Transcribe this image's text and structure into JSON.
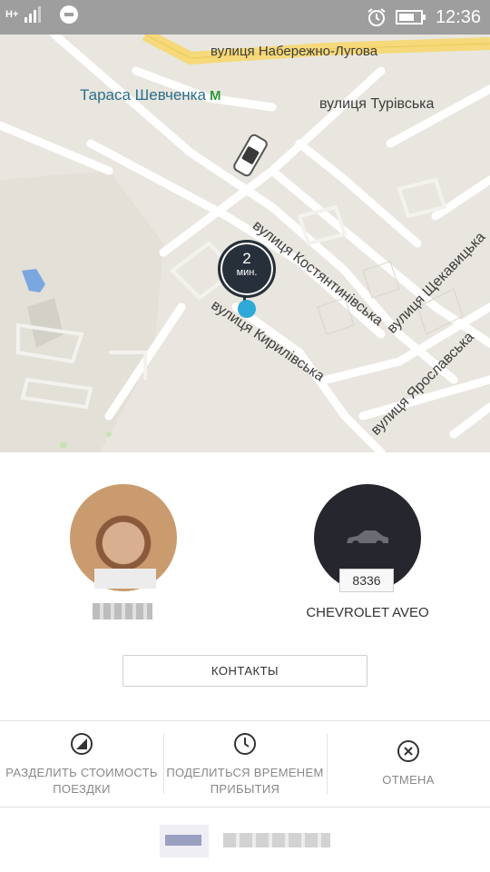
{
  "status_bar": {
    "network": "H+",
    "time": "12:36"
  },
  "map": {
    "metro_station": "Тараса Шевченка",
    "metro_symbol": "M",
    "streets": {
      "naberezhno_luhova": "вулиця Набережно-Лугова",
      "turivska": "вулиця Турівська",
      "kostiantynivska": "вулиця Костянтинівська",
      "shchekavytska": "вулиця Щекавицька",
      "kyrylivska": "вулиця Кирилівська",
      "yaroslavska": "вулиця Ярославська"
    },
    "eta": {
      "value": "2",
      "unit": "мин."
    }
  },
  "driver": {
    "avatar": "driver-photo"
  },
  "vehicle": {
    "plate": "8336",
    "model": "CHEVROLET AVEO"
  },
  "contacts_button": "КОНТАКТЫ",
  "actions": [
    {
      "label": "РАЗДЕЛИТЬ СТОИМОСТЬ ПОЕЗДКИ",
      "icon": "split-fare-icon"
    },
    {
      "label": "ПОДЕЛИТЬСЯ ВРЕМЕНЕМ ПРИБЫТИЯ",
      "icon": "clock-icon"
    },
    {
      "label": "ОТМЕНА",
      "icon": "cancel-icon"
    }
  ],
  "colors": {
    "status_bar": "#9e9e9e",
    "map_background": "#e9e6df",
    "highway": "#f5d97a",
    "eta_pin": "#27303a",
    "location_dot": "#2fa9d8",
    "car_circle": "#25262e"
  }
}
